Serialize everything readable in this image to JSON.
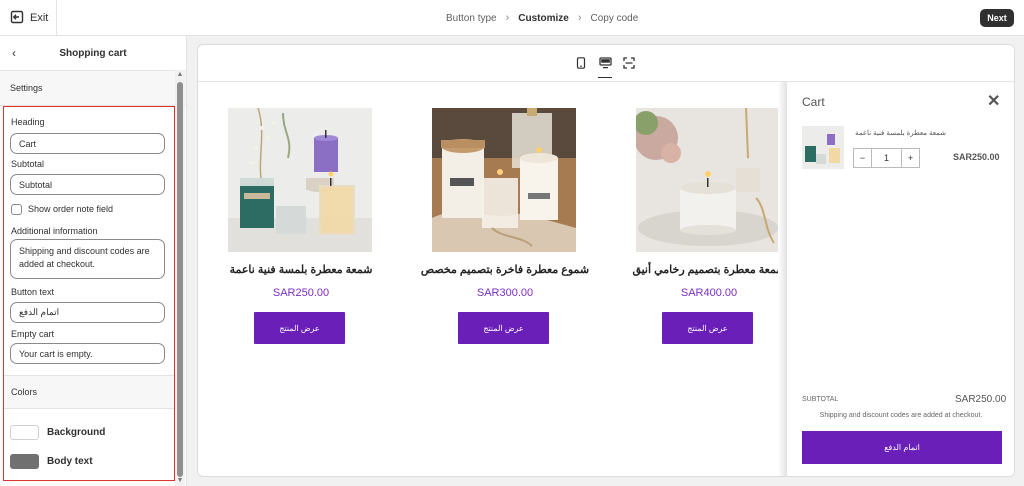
{
  "topbar": {
    "exit_label": "Exit",
    "steps": [
      "Button type",
      "Customize",
      "Copy code"
    ],
    "next_label": "Next"
  },
  "sidebar": {
    "title": "Shopping cart",
    "settings_label": "Settings",
    "heading_label": "Heading",
    "heading_value": "Cart",
    "subtotal_label": "Subtotal",
    "subtotal_value": "Subtotal",
    "order_note_label": "Show order note field",
    "order_note_checked": false,
    "additional_label": "Additional information",
    "additional_value": "Shipping and discount codes are added at checkout.",
    "button_text_label": "Button text",
    "button_text_value": "اتمام الدفع",
    "empty_cart_label": "Empty cart",
    "empty_cart_value": "Your cart is empty.",
    "colors_label": "Colors",
    "background_label": "Background",
    "background_color": "#ffffff",
    "body_text_label": "Body text",
    "body_text_color": "#707070"
  },
  "preview": {
    "devices": [
      "mobile-icon",
      "desktop-icon",
      "fullscreen-icon"
    ],
    "products": [
      {
        "title": "شمعة معطرة بلمسة فنية ناعمة",
        "price": "SAR250.00",
        "button": "عرض المنتج"
      },
      {
        "title": "شموع معطرة فاخرة بتصميم مخصص",
        "price": "SAR300.00",
        "button": "عرض المنتج"
      },
      {
        "title": "شمعة معطرة بتصميم رخامي أنيق",
        "price": "SAR400.00",
        "button": "عرض المنتج"
      }
    ],
    "accent_color": "#6a1fb8",
    "price_color": "#7b2cbf"
  },
  "cart": {
    "title": "Cart",
    "item_name": "شمعة معطرة بلمسة فنية ناعمة",
    "qty": "1",
    "minus": "−",
    "plus": "+",
    "item_price": "SAR250.00",
    "subtotal_label": "SUBTOTAL",
    "subtotal_value": "SAR250.00",
    "note": "Shipping and discount codes are added at checkout.",
    "checkout_label": "اتمام الدفع"
  }
}
